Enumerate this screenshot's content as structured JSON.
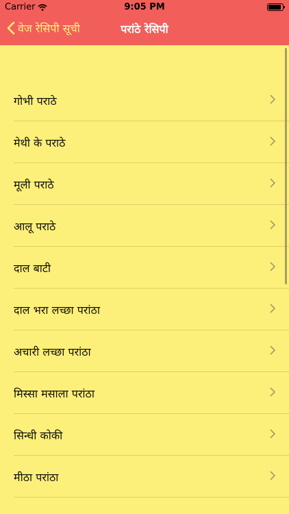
{
  "status_bar": {
    "carrier": "Carrier",
    "time": "9:05 PM"
  },
  "nav": {
    "back_label": "वेज रेसिपी सूची",
    "title": "परांठे रेसिपी"
  },
  "recipes": [
    {
      "label": "गोभी पराठे"
    },
    {
      "label": "मेथी के पराठे"
    },
    {
      "label": "मूली पराठे"
    },
    {
      "label": "आलू पराठे"
    },
    {
      "label": "दाल बाटी"
    },
    {
      "label": "दाल भरा लच्छा परांठा"
    },
    {
      "label": "अचारी लच्छा परांठा"
    },
    {
      "label": "मिस्सा मसाला परांठा"
    },
    {
      "label": "सिन्धी कोकी"
    },
    {
      "label": "मीठा परांठा"
    }
  ],
  "colors": {
    "header": "#f25e5a",
    "background": "#fdf07a",
    "back_text": "#fdf07a",
    "title_text": "#ffffff"
  }
}
